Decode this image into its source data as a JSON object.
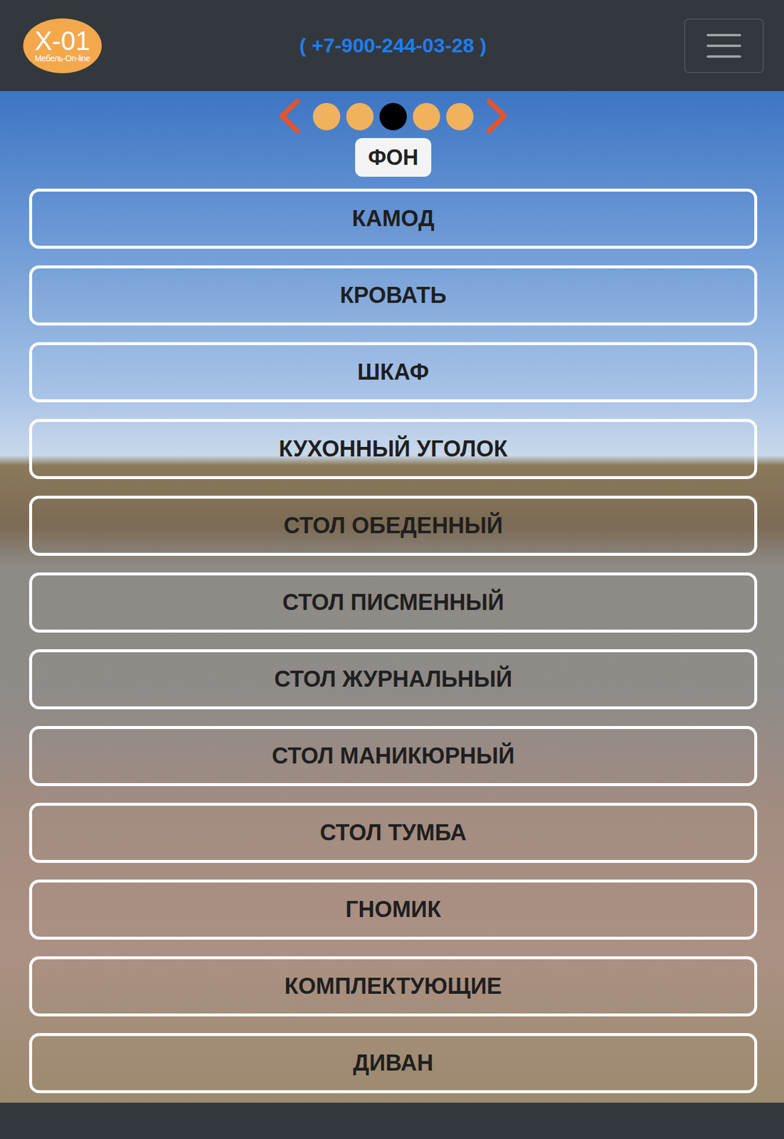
{
  "header": {
    "logo": {
      "title": "X-01",
      "subtitle": "Мебель-On-line"
    },
    "phone": "( +7-900-244-03-28 )"
  },
  "carousel": {
    "dots": [
      {
        "selected": false
      },
      {
        "selected": false
      },
      {
        "selected": true
      },
      {
        "selected": false
      },
      {
        "selected": false
      }
    ],
    "label": "ФОН"
  },
  "categories": [
    "КАМОД",
    "КРОВАТЬ",
    "ШКАФ",
    "КУХОННЫЙ УГОЛОК",
    "СТОЛ ОБЕДЕННЫЙ",
    "СТОЛ ПИСМЕННЫЙ",
    "СТОЛ ЖУРНАЛЬНЫЙ",
    "СТОЛ МАНИКЮРНЫЙ",
    "СТОЛ ТУМБА",
    "ГНОМИК",
    "КОМПЛЕКТУЮЩИЕ",
    "ДИВАН"
  ]
}
